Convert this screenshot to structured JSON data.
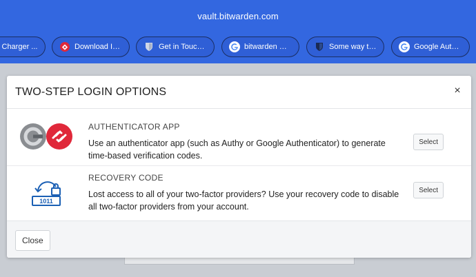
{
  "browser": {
    "url": "vault.bitwarden.com",
    "tabs": [
      {
        "label": "l Charger ...",
        "icon": "charger-icon"
      },
      {
        "label": "Download Ins...",
        "icon": "authy-icon"
      },
      {
        "label": "Get in Touch | ...",
        "icon": "bitwarden-shield-icon"
      },
      {
        "label": "bitwarden MF...",
        "icon": "google-icon"
      },
      {
        "label": "Some way to ...",
        "icon": "bitwarden-shield-icon"
      },
      {
        "label": "Google Authe...",
        "icon": "google-icon"
      }
    ]
  },
  "modal": {
    "title": "TWO-STEP LOGIN OPTIONS",
    "close_glyph": "×",
    "options": [
      {
        "title": "AUTHENTICATOR APP",
        "description": "Use an authenticator app (such as Authy or Google Authenticator) to generate time-based verification codes.",
        "button": "Select",
        "icon": "authenticator-app-icon"
      },
      {
        "title": "RECOVERY CODE",
        "description": "Lost access to all of your two-factor providers? Use your recovery code to disable all two-factor providers from your account.",
        "button": "Select",
        "icon": "recovery-code-icon",
        "icon_text": "1011"
      }
    ],
    "footer_button": "Close"
  },
  "colors": {
    "browser_bar": "#3367e0",
    "authy_red": "#e0283a",
    "recovery_blue": "#1a5fb4"
  }
}
